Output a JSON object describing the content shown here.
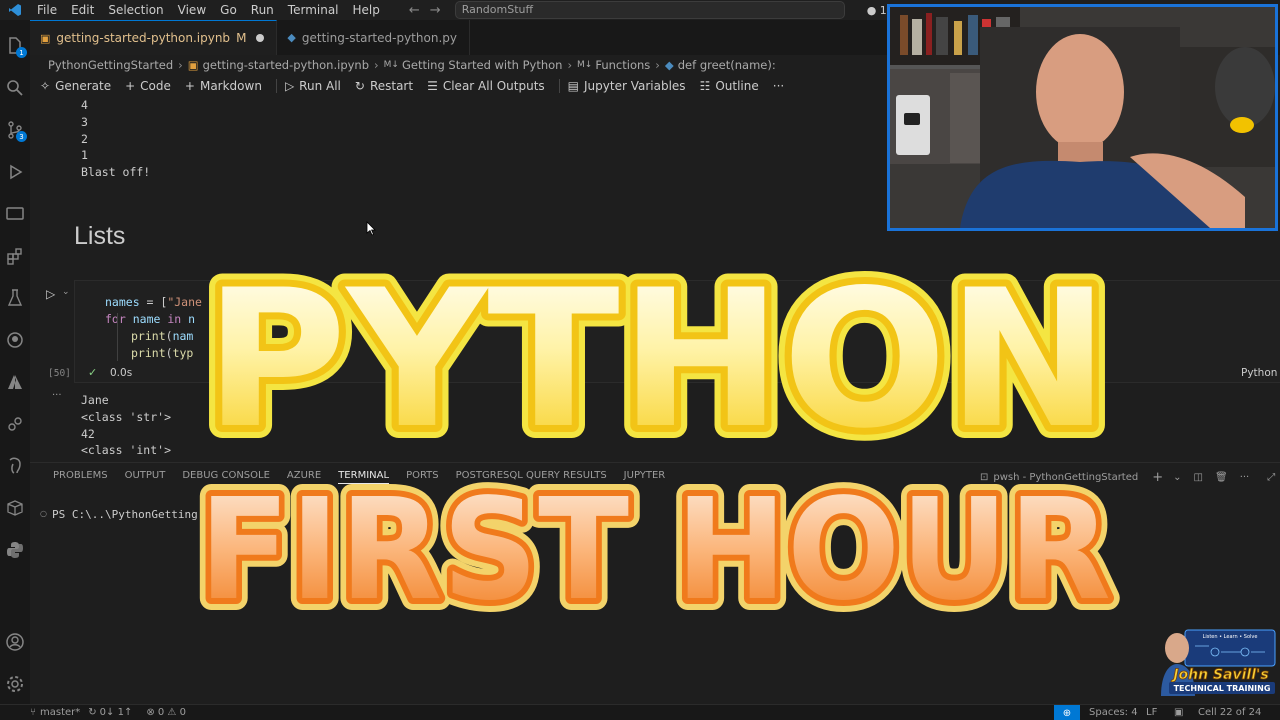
{
  "titlebar": {
    "menus": [
      "File",
      "Edit",
      "Selection",
      "View",
      "Go",
      "Run",
      "Terminal",
      "Help"
    ],
    "search_text": "RandomStuff",
    "notif": "● 1"
  },
  "activity": {
    "explorer_badge": "1",
    "scm_badge": "3"
  },
  "tabs": [
    {
      "label": "getting-started-python.ipynb",
      "status": "M"
    },
    {
      "label": "getting-started-python.py"
    }
  ],
  "breadcrumb": [
    "PythonGettingStarted",
    "getting-started-python.ipynb",
    "Getting Started with Python",
    "Functions",
    "def greet(name):"
  ],
  "toolbar": {
    "generate": "Generate",
    "code": "Code",
    "markdown": "Markdown",
    "run_all": "Run All",
    "restart": "Restart",
    "clear_all": "Clear All Outputs",
    "variables": "Jupyter Variables",
    "outline": "Outline",
    "more": "···"
  },
  "prev_output": [
    "4",
    "3",
    "2",
    "1",
    "Blast off!"
  ],
  "heading": "Lists",
  "cell": {
    "lines": [
      "names = [\"Jane",
      "for name in n",
      "    print(nam",
      "    print(typ"
    ],
    "exec_count": "[50]",
    "duration": "0.0s",
    "language": "Python"
  },
  "cell_output": [
    "Jane",
    "<class 'str'>",
    "42",
    "<class 'int'>"
  ],
  "panel": {
    "tabs": [
      "PROBLEMS",
      "OUTPUT",
      "DEBUG CONSOLE",
      "AZURE",
      "TERMINAL",
      "PORTS",
      "POSTGRESQL QUERY RESULTS",
      "JUPYTER"
    ],
    "shell": "pwsh - PythonGettingStarted",
    "prompt": "PS C:\\..\\PythonGetting"
  },
  "status": {
    "branch": "master*",
    "sync": "0↓ 1↑",
    "problems": "⊗ 0 ⚠ 0",
    "spaces": "Spaces: 4",
    "eol": "LF",
    "cell_pos": "Cell 22 of 24"
  },
  "overlay": {
    "line1": "PYTHON",
    "line2": "FIRST HOUR"
  },
  "brand": {
    "top": "Listen • Learn • Solve",
    "name": "John Savill's",
    "sub": "TECHNICAL TRAINING"
  }
}
